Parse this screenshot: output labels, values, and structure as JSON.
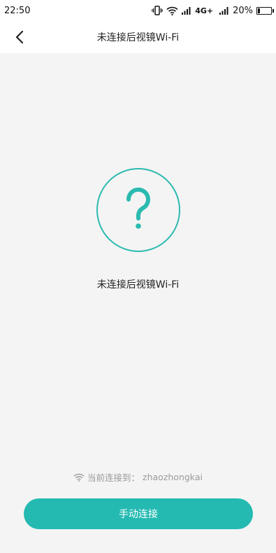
{
  "status_bar": {
    "time": "22:50",
    "network_label": "4G+",
    "battery_percent": "20%",
    "battery_level": 0.2,
    "icons": [
      "vibrate-icon",
      "wifi-icon",
      "signal-icon",
      "signal-icon",
      "battery-icon"
    ]
  },
  "header": {
    "back_icon": "chevron-left-icon",
    "title": "未连接后视镜Wi-Fi"
  },
  "main": {
    "status_icon": "question-mark-icon",
    "status_text": "未连接后视镜Wi-Fi",
    "current_connection": {
      "icon": "wifi-icon",
      "label": "当前连接到：",
      "ssid": "zhaozhongkai"
    },
    "manual_connect_label": "手动连接"
  },
  "colors": {
    "accent": "#24bab1",
    "background": "#f4f4f4",
    "bar_background": "#ffffff"
  }
}
